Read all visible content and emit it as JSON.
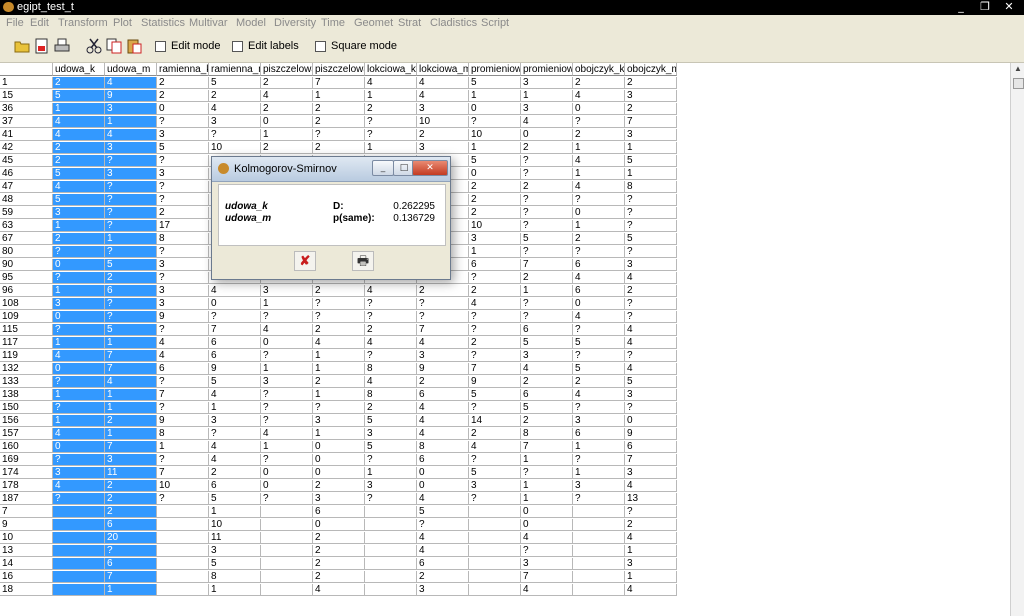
{
  "window": {
    "title": "egipt_test_t",
    "min": "_",
    "max": "❐",
    "close": "✕"
  },
  "menu": [
    "File",
    "Edit",
    "Transform",
    "Plot",
    "Statistics",
    "Multivar",
    "Model",
    "Diversity",
    "Time",
    "Geomet",
    "Strat",
    "Cladistics",
    "Script"
  ],
  "toolbar": {
    "edit_mode": "Edit mode",
    "edit_labels": "Edit labels",
    "square_mode": "Square mode"
  },
  "columns": [
    "udowa_k",
    "udowa_m",
    "ramienna_k",
    "ramienna_m",
    "piszczelowa",
    "piszczelowa",
    "lokciowa_k",
    "lokciowa_m",
    "promieniowa",
    "promieniowa",
    "obojczyk_k",
    "obojczyk_m"
  ],
  "rows": [
    [
      "1",
      "2",
      "4",
      "2",
      "5",
      "2",
      "7",
      "4",
      "4",
      "5",
      "3",
      "2",
      "2"
    ],
    [
      "15",
      "5",
      "9",
      "2",
      "2",
      "4",
      "1",
      "1",
      "4",
      "1",
      "1",
      "4",
      "3"
    ],
    [
      "36",
      "1",
      "3",
      "0",
      "4",
      "2",
      "2",
      "2",
      "3",
      "0",
      "3",
      "0",
      "2"
    ],
    [
      "37",
      "4",
      "1",
      "?",
      "3",
      "0",
      "2",
      "?",
      "10",
      "?",
      "4",
      "?",
      "7"
    ],
    [
      "41",
      "4",
      "4",
      "3",
      "?",
      "1",
      "?",
      "?",
      "2",
      "10",
      "0",
      "2",
      "3"
    ],
    [
      "42",
      "2",
      "3",
      "5",
      "10",
      "2",
      "2",
      "1",
      "3",
      "1",
      "2",
      "1",
      "1"
    ],
    [
      "45",
      "2",
      "?",
      "?",
      "",
      "",
      "",
      "",
      "",
      "5",
      "?",
      "4",
      "5"
    ],
    [
      "46",
      "5",
      "3",
      "3",
      "",
      "",
      "",
      "",
      "",
      "0",
      "?",
      "1",
      "1"
    ],
    [
      "47",
      "4",
      "?",
      "?",
      "",
      "",
      "",
      "",
      "",
      "2",
      "2",
      "4",
      "8"
    ],
    [
      "48",
      "5",
      "?",
      "?",
      "",
      "",
      "",
      "",
      "",
      "2",
      "?",
      "?",
      "?"
    ],
    [
      "59",
      "3",
      "?",
      "2",
      "",
      "",
      "",
      "",
      "",
      "2",
      "?",
      "0",
      "?"
    ],
    [
      "63",
      "1",
      "?",
      "17",
      "",
      "",
      "",
      "",
      "",
      "10",
      "?",
      "1",
      "?"
    ],
    [
      "67",
      "2",
      "1",
      "8",
      "",
      "",
      "",
      "",
      "",
      "3",
      "5",
      "2",
      "5"
    ],
    [
      "80",
      "?",
      "?",
      "?",
      "",
      "",
      "",
      "",
      "",
      "1",
      "?",
      "?",
      "?"
    ],
    [
      "90",
      "0",
      "5",
      "3",
      "",
      "",
      "",
      "",
      "",
      "6",
      "7",
      "6",
      "3"
    ],
    [
      "95",
      "?",
      "2",
      "?",
      "7",
      "?",
      "0",
      "?",
      "1",
      "?",
      "2",
      "4",
      "4"
    ],
    [
      "96",
      "1",
      "6",
      "3",
      "4",
      "3",
      "2",
      "4",
      "2",
      "2",
      "1",
      "6",
      "2"
    ],
    [
      "108",
      "3",
      "?",
      "3",
      "0",
      "1",
      "?",
      "?",
      "?",
      "4",
      "?",
      "0",
      "?"
    ],
    [
      "109",
      "0",
      "?",
      "9",
      "?",
      "?",
      "?",
      "?",
      "?",
      "?",
      "?",
      "4",
      "?"
    ],
    [
      "115",
      "?",
      "5",
      "?",
      "7",
      "4",
      "2",
      "2",
      "7",
      "?",
      "6",
      "?",
      "4"
    ],
    [
      "117",
      "1",
      "1",
      "4",
      "6",
      "0",
      "4",
      "4",
      "4",
      "2",
      "5",
      "5",
      "4"
    ],
    [
      "119",
      "4",
      "7",
      "4",
      "6",
      "?",
      "1",
      "?",
      "3",
      "?",
      "3",
      "?",
      "?"
    ],
    [
      "132",
      "0",
      "7",
      "6",
      "9",
      "1",
      "1",
      "8",
      "9",
      "7",
      "4",
      "5",
      "4"
    ],
    [
      "133",
      "?",
      "4",
      "?",
      "5",
      "3",
      "2",
      "4",
      "2",
      "9",
      "2",
      "2",
      "5"
    ],
    [
      "138",
      "1",
      "1",
      "7",
      "4",
      "?",
      "1",
      "8",
      "6",
      "5",
      "6",
      "4",
      "3"
    ],
    [
      "150",
      "?",
      "1",
      "?",
      "1",
      "?",
      "?",
      "2",
      "4",
      "?",
      "5",
      "?",
      "?"
    ],
    [
      "156",
      "1",
      "2",
      "9",
      "3",
      "?",
      "3",
      "5",
      "4",
      "14",
      "2",
      "3",
      "0"
    ],
    [
      "157",
      "4",
      "1",
      "8",
      "?",
      "4",
      "1",
      "3",
      "4",
      "2",
      "8",
      "6",
      "9"
    ],
    [
      "160",
      "0",
      "7",
      "1",
      "4",
      "1",
      "0",
      "5",
      "8",
      "4",
      "7",
      "1",
      "6"
    ],
    [
      "169",
      "?",
      "3",
      "?",
      "4",
      "?",
      "0",
      "?",
      "6",
      "?",
      "1",
      "?",
      "7"
    ],
    [
      "174",
      "3",
      "11",
      "7",
      "2",
      "0",
      "0",
      "1",
      "0",
      "5",
      "?",
      "1",
      "3"
    ],
    [
      "178",
      "4",
      "2",
      "10",
      "6",
      "0",
      "2",
      "3",
      "0",
      "3",
      "1",
      "3",
      "4"
    ],
    [
      "187",
      "?",
      "2",
      "?",
      "5",
      "?",
      "3",
      "?",
      "4",
      "?",
      "1",
      "?",
      "13"
    ],
    [
      "7",
      "",
      "2",
      "",
      "1",
      "",
      "6",
      "",
      "5",
      "",
      "0",
      "",
      "?"
    ],
    [
      "9",
      "",
      "6",
      "",
      "10",
      "",
      "0",
      "",
      "?",
      "",
      "0",
      "",
      "2"
    ],
    [
      "10",
      "",
      "20",
      "",
      "11",
      "",
      "2",
      "",
      "4",
      "",
      "4",
      "",
      "4"
    ],
    [
      "13",
      "",
      "?",
      "",
      "3",
      "",
      "2",
      "",
      "4",
      "",
      "?",
      "",
      "1"
    ],
    [
      "14",
      "",
      "6",
      "",
      "5",
      "",
      "2",
      "",
      "6",
      "",
      "3",
      "",
      "3"
    ],
    [
      "16",
      "",
      "7",
      "",
      "8",
      "",
      "2",
      "",
      "2",
      "",
      "7",
      "",
      "1"
    ],
    [
      "18",
      "",
      "1",
      "",
      "1",
      "",
      "4",
      "",
      "3",
      "",
      "4",
      "",
      "4"
    ]
  ],
  "dialog": {
    "title": "Kolmogorov-Smirnov",
    "sample1": "udowa_k",
    "sample2": "udowa_m",
    "d_label": "D:",
    "d_value": "0.262295",
    "p_label": "p(same):",
    "p_value": "0.136729",
    "min": "_",
    "max": "□",
    "close": "✕",
    "close_btn": "✘",
    "print_btn": "🖶"
  },
  "colors": {
    "selection": "#3399ff",
    "titlebar": "#000000"
  }
}
